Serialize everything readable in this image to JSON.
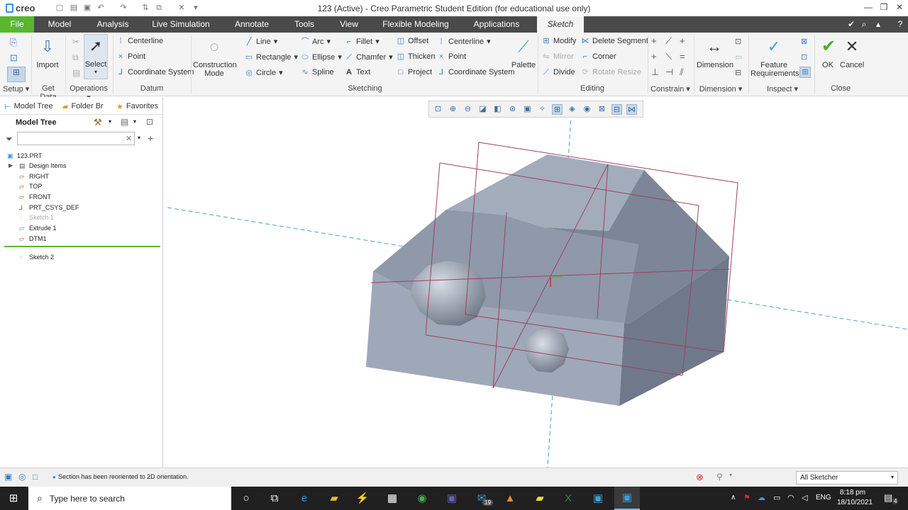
{
  "app": {
    "logo": "creo",
    "window_title": "123 (Active) - Creo Parametric Student Edition (for educational use only)"
  },
  "menu_tabs": [
    "File",
    "Model",
    "Analysis",
    "Live Simulation",
    "Annotate",
    "Tools",
    "View",
    "Flexible Modeling",
    "Applications",
    "Sketch"
  ],
  "ribbon": {
    "setup": {
      "label": "Setup"
    },
    "get_data": {
      "import": "Import",
      "label": "Get Data"
    },
    "operations": {
      "select": "Select",
      "label": "Operations"
    },
    "datum": {
      "centerline": "Centerline",
      "point": "Point",
      "coordinate_system": "Coordinate System",
      "label": "Datum"
    },
    "sketching": {
      "construction_mode": [
        "Construction",
        "Mode"
      ],
      "line": "Line",
      "rectangle": "Rectangle",
      "circle": "Circle",
      "arc": "Arc",
      "ellipse": "Ellipse",
      "spline": "Spline",
      "fillet": "Fillet",
      "chamfer": "Chamfer",
      "text": "Text",
      "offset": "Offset",
      "thicken": "Thicken",
      "project": "Project",
      "centerline": "Centerline",
      "point": "Point",
      "coordinate_system": "Coordinate System",
      "palette": "Palette",
      "label": "Sketching"
    },
    "editing": {
      "modify": "Modify",
      "delete_segment": "Delete Segment",
      "mirror": "Mirror",
      "corner": "Corner",
      "divide": "Divide",
      "rotate_resize": "Rotate Resize",
      "label": "Editing"
    },
    "constrain": {
      "label": "Constrain"
    },
    "dimension": {
      "dimension": "Dimension",
      "label": "Dimension"
    },
    "inspect": {
      "feature_requirements": [
        "Feature",
        "Requirements"
      ],
      "label": "Inspect"
    },
    "close": {
      "ok": "OK",
      "cancel": "Cancel",
      "label": "Close"
    }
  },
  "left_panel": {
    "tabs": [
      "Model Tree",
      "Folder Br",
      "Favorites"
    ],
    "header": "Model Tree",
    "tree": [
      "123.PRT",
      "Design Items",
      "RIGHT",
      "TOP",
      "FRONT",
      "PRT_CSYS_DEF",
      "Sketch 1",
      "Extrude 1",
      "DTM1",
      "Sketch 2"
    ]
  },
  "status": {
    "message": "Section has been reoriented to 2D orientation.",
    "filter": "All Sketcher"
  },
  "taskbar": {
    "search_placeholder": "Type here to search",
    "lang": "ENG",
    "time": "8:18 pm",
    "date": "18/10/2021",
    "mail_badge": "19",
    "notif_badge": "4"
  },
  "colors": {
    "file_tab": "#5ab52f",
    "tab_bar": "#4a4a4a",
    "model_face": "#9aa4b4",
    "sketch_line": "#a04060",
    "datum_axis": "#40a8b8"
  }
}
